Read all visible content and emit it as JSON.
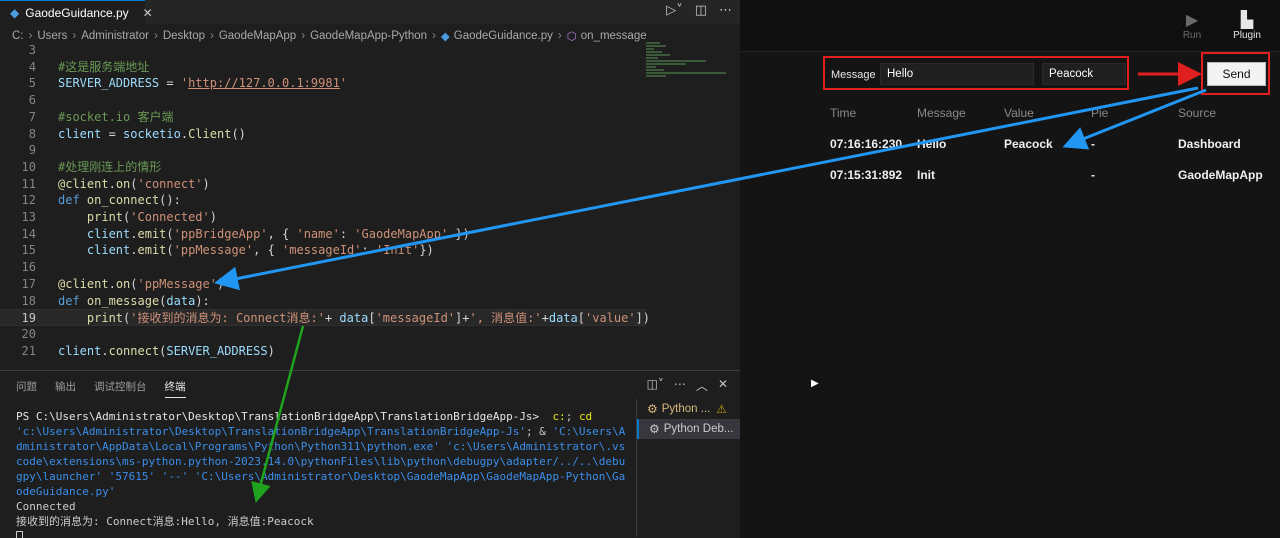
{
  "editor_tab": {
    "name": "GaodeGuidance.py",
    "close": "✕"
  },
  "breadcrumb": [
    "C:",
    "Users",
    "Administrator",
    "Desktop",
    "GaodeMapApp",
    "GaodeMapApp-Python",
    "GaodeGuidance.py",
    "on_message"
  ],
  "code_lines": [
    {
      "n": "3",
      "html": ""
    },
    {
      "n": "4",
      "html": "<span class='c-com'>#这是服务端地址</span>"
    },
    {
      "n": "5",
      "html": "<span class='c-var'>SERVER_ADDRESS</span><span class='c-pl'> = </span><span class='c-str'>'</span><span class='c-url'>http://127.0.0.1:9981</span><span class='c-str'>'</span>"
    },
    {
      "n": "6",
      "html": ""
    },
    {
      "n": "7",
      "html": "<span class='c-com'>#socket.io 客户端</span>"
    },
    {
      "n": "8",
      "html": "<span class='c-var'>client</span><span class='c-pl'> = </span><span class='c-var'>socketio</span><span class='c-pl'>.</span><span class='c-fn'>Client</span><span class='c-pl'>()</span>"
    },
    {
      "n": "9",
      "html": ""
    },
    {
      "n": "10",
      "html": "<span class='c-com'>#处理刚连上的情形</span>"
    },
    {
      "n": "11",
      "html": "<span class='c-fn'>@client</span><span class='c-pl'>.</span><span class='c-fn'>on</span><span class='c-pl'>(</span><span class='c-str'>'connect'</span><span class='c-pl'>)</span>"
    },
    {
      "n": "12",
      "html": "<span class='c-kw'>def</span><span class='c-pl'> </span><span class='c-fn'>on_connect</span><span class='c-pl'>():</span>"
    },
    {
      "n": "13",
      "html": "<span class='c-pl'>    </span><span class='c-fn'>print</span><span class='c-pl'>(</span><span class='c-str'>'Connected'</span><span class='c-pl'>)</span>"
    },
    {
      "n": "14",
      "html": "<span class='c-pl'>    </span><span class='c-var'>client</span><span class='c-pl'>.</span><span class='c-fn'>emit</span><span class='c-pl'>(</span><span class='c-str'>'ppBridgeApp'</span><span class='c-pl'>, { </span><span class='c-str'>'name'</span><span class='c-pl'>: </span><span class='c-str'>'GaodeMapApp'</span><span class='c-pl'> })</span>"
    },
    {
      "n": "15",
      "html": "<span class='c-pl'>    </span><span class='c-var'>client</span><span class='c-pl'>.</span><span class='c-fn'>emit</span><span class='c-pl'>(</span><span class='c-str'>'ppMessage'</span><span class='c-pl'>, { </span><span class='c-str'>'messageId'</span><span class='c-pl'>: </span><span class='c-str'>'Init'</span><span class='c-pl'>})</span>"
    },
    {
      "n": "16",
      "html": ""
    },
    {
      "n": "17",
      "html": "<span class='c-fn'>@client</span><span class='c-pl'>.</span><span class='c-fn'>on</span><span class='c-pl'>(</span><span class='c-str'>'ppMessage'</span><span class='c-pl'>)</span>"
    },
    {
      "n": "18",
      "html": "<span class='c-kw'>def</span><span class='c-pl'> </span><span class='c-fn'>on_message</span><span class='c-pl'>(</span><span class='c-var'>data</span><span class='c-pl'>):</span>"
    },
    {
      "n": "19",
      "html": "<span class='c-pl'>    </span><span class='c-fn'>print</span><span class='c-pl'>(</span><span class='c-str'>'接收到的消息为: Connect消息:'</span><span class='c-pl'>+ </span><span class='c-var'>data</span><span class='c-pl'>[</span><span class='c-str'>'messageId'</span><span class='c-pl'>]+</span><span class='c-str'>', 消息值:'</span><span class='c-pl'>+</span><span class='c-var'>data</span><span class='c-pl'>[</span><span class='c-str'>'value'</span><span class='c-pl'>])</span>",
      "current": true
    },
    {
      "n": "20",
      "html": ""
    },
    {
      "n": "21",
      "html": "<span class='c-var'>client</span><span class='c-pl'>.</span><span class='c-fn'>connect</span><span class='c-pl'>(</span><span class='c-var'>SERVER_ADDRESS</span><span class='c-pl'>)</span>"
    }
  ],
  "panel": {
    "tabs": [
      "问题",
      "输出",
      "调试控制台",
      "终端"
    ],
    "active_tab": "终端",
    "terminal_html": "<span class='wht'>PS C:\\Users\\Administrator\\Desktop\\TranslationBridgeApp\\TranslationBridgeApp-Js&gt;</span>  <span class='yel'>c:</span>; <span class='yel'>cd</span> <span class='path'>'c:\\Users\\Administrator\\Desktop\\TranslationBridgeApp\\TranslationBridgeApp-Js'</span>; &amp; <span class='path'>'C:\\Users\\Administrator\\AppData\\Local\\Programs\\Python\\Python311\\python.exe' 'c:\\Users\\Administrator\\.vscode\\extensions\\ms-python.python-2023.14.0\\pythonFiles\\lib\\python\\debugpy\\adapter/../..\\debugpy\\launcher' '57615' '--' 'C:\\Users\\Administrator\\Desktop\\GaodeMapApp\\GaodeMapApp-Python\\GaodeGuidance.py'</span>\nConnected\n接收到的消息为: Connect消息:Hello, 消息值:Peacock\n",
    "sessions": [
      "Python ...",
      "Python Deb..."
    ]
  },
  "app": {
    "run_label": "Run",
    "plugin_label": "Plugin",
    "message_label": "Message",
    "message_value": "Hello",
    "value_value": "Peacock",
    "send_label": "Send",
    "columns": [
      "Time",
      "Message",
      "Value",
      "Pie",
      "Source"
    ],
    "rows": [
      [
        "07:16:16:230",
        "Hello",
        "Peacock",
        "-",
        "Dashboard"
      ],
      [
        "07:15:31:892",
        "Init",
        "",
        "-",
        "GaodeMapApp"
      ]
    ]
  },
  "colors": {
    "annotation_red": "#e02020",
    "annotation_blue": "#2196f3",
    "annotation_green": "#1fa31f"
  }
}
